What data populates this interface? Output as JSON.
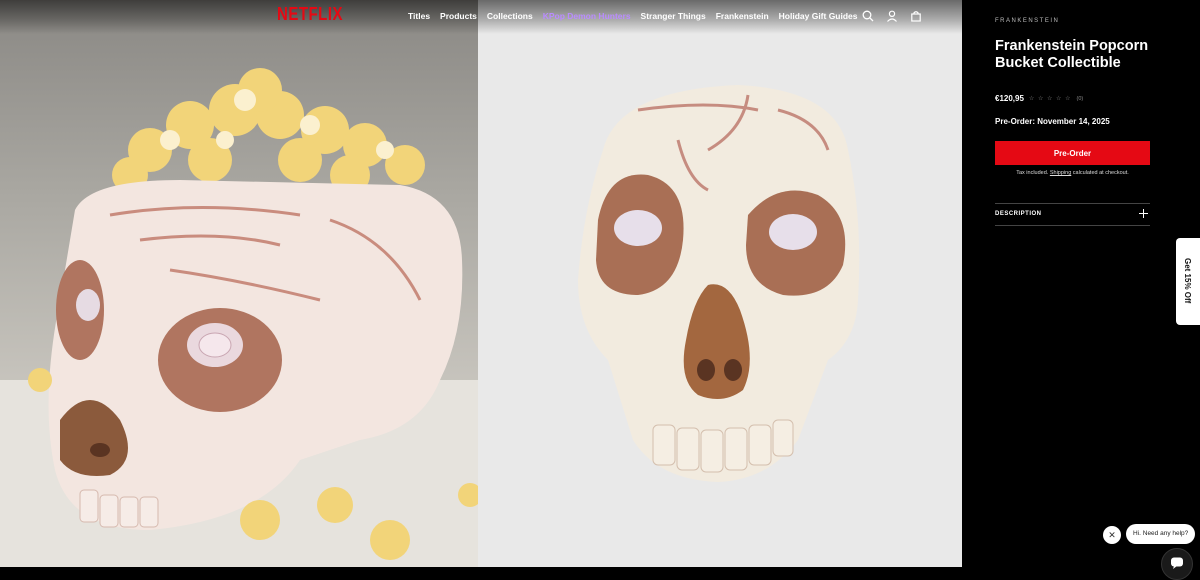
{
  "nav": {
    "logo": "NETFLIX",
    "links": [
      {
        "label": "Titles"
      },
      {
        "label": "Products"
      },
      {
        "label": "Collections"
      },
      {
        "label": "KPop Demon Hunters",
        "accent": "#b98bff"
      },
      {
        "label": "Stranger Things"
      },
      {
        "label": "Frankenstein"
      },
      {
        "label": "Holiday Gift Guides"
      }
    ],
    "icons": [
      "search-icon",
      "account-icon",
      "bag-icon"
    ]
  },
  "gallery": {
    "images": [
      "popcorn-filled skull photo",
      "skull product photo"
    ]
  },
  "product": {
    "eyebrow": "FRANKENSTEIN",
    "title": "Frankenstein Popcorn Bucket Collectible",
    "price": "€120,95",
    "rating_stars": "☆ ☆ ☆ ☆ ☆",
    "review_count": "(0)",
    "preorder_date": "Pre-Order: November 14, 2025",
    "button_label": "Pre-Order",
    "tax_note_prefix": "Tax included. ",
    "tax_note_link": "Shipping",
    "tax_note_suffix": " calculated at checkout.",
    "description_label": "DESCRIPTION"
  },
  "promo": {
    "label": "Get 15% Off"
  },
  "chat": {
    "close_glyph": "✕",
    "bubble_text": "Hi. Need any help?"
  },
  "colors": {
    "brand_red": "#e50914",
    "panel_bg": "#000000",
    "accent_purple": "#b98bff"
  }
}
